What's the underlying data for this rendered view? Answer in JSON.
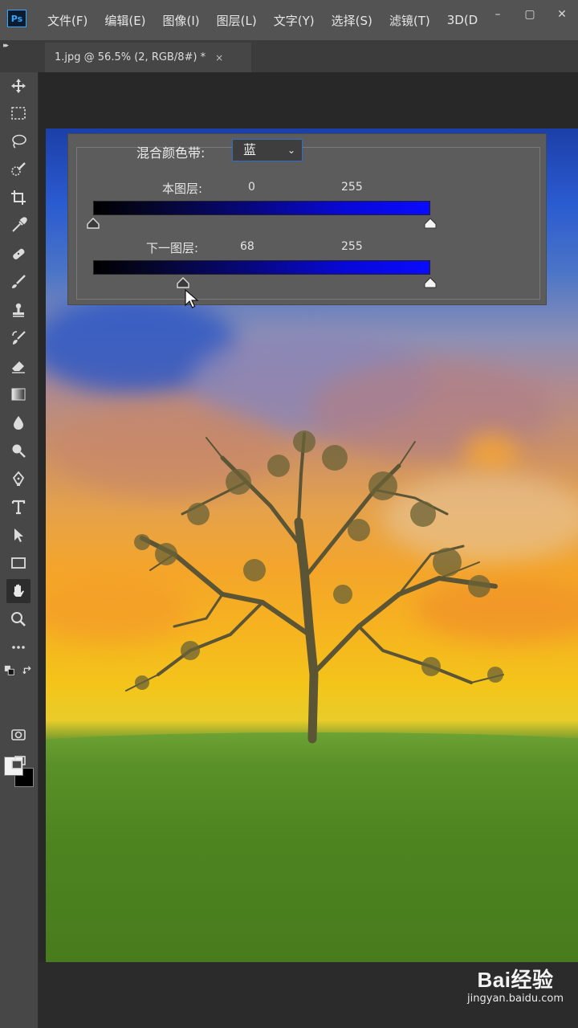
{
  "app": {
    "logo_text": "Ps"
  },
  "menu": {
    "items": [
      "文件(F)",
      "编辑(E)",
      "图像(I)",
      "图层(L)",
      "文字(Y)",
      "选择(S)",
      "滤镜(T)",
      "3D(D"
    ]
  },
  "window_controls": {
    "minimize": "–",
    "maximize": "▢",
    "close": "✕"
  },
  "tabbar": {
    "collapse": "▸▸",
    "doc_title": "1.jpg @ 56.5% (2, RGB/8#) *",
    "close": "×"
  },
  "blend_if": {
    "label": "混合颜色带:",
    "channel": "蓝",
    "this_layer": {
      "label": "本图层:",
      "black": "0",
      "white": "255",
      "black_level": 0,
      "white_level": 255
    },
    "underlying": {
      "label": "下一图层:",
      "black": "68",
      "white": "255",
      "black_level": 68,
      "white_level": 255
    }
  },
  "colors": {
    "menubar": "#535353",
    "toolbar": "#474747",
    "accent": "#31a8ff",
    "gradient_end": "#0a0aff"
  },
  "tools": [
    "move-tool-icon",
    "marquee-tool-icon",
    "lasso-tool-icon",
    "quick-select-tool-icon",
    "crop-tool-icon",
    "eyedropper-tool-icon",
    "healing-brush-tool-icon",
    "brush-tool-icon",
    "stamp-tool-icon",
    "history-brush-tool-icon",
    "eraser-tool-icon",
    "gradient-tool-icon",
    "blur-tool-icon",
    "dodge-tool-icon",
    "pen-tool-icon",
    "type-tool-icon",
    "path-select-tool-icon",
    "rectangle-tool-icon",
    "hand-tool-icon",
    "zoom-tool-icon",
    "more-tools-icon"
  ],
  "watermark": {
    "main": "Bai经验",
    "sub": "jingyan.baidu.com"
  }
}
